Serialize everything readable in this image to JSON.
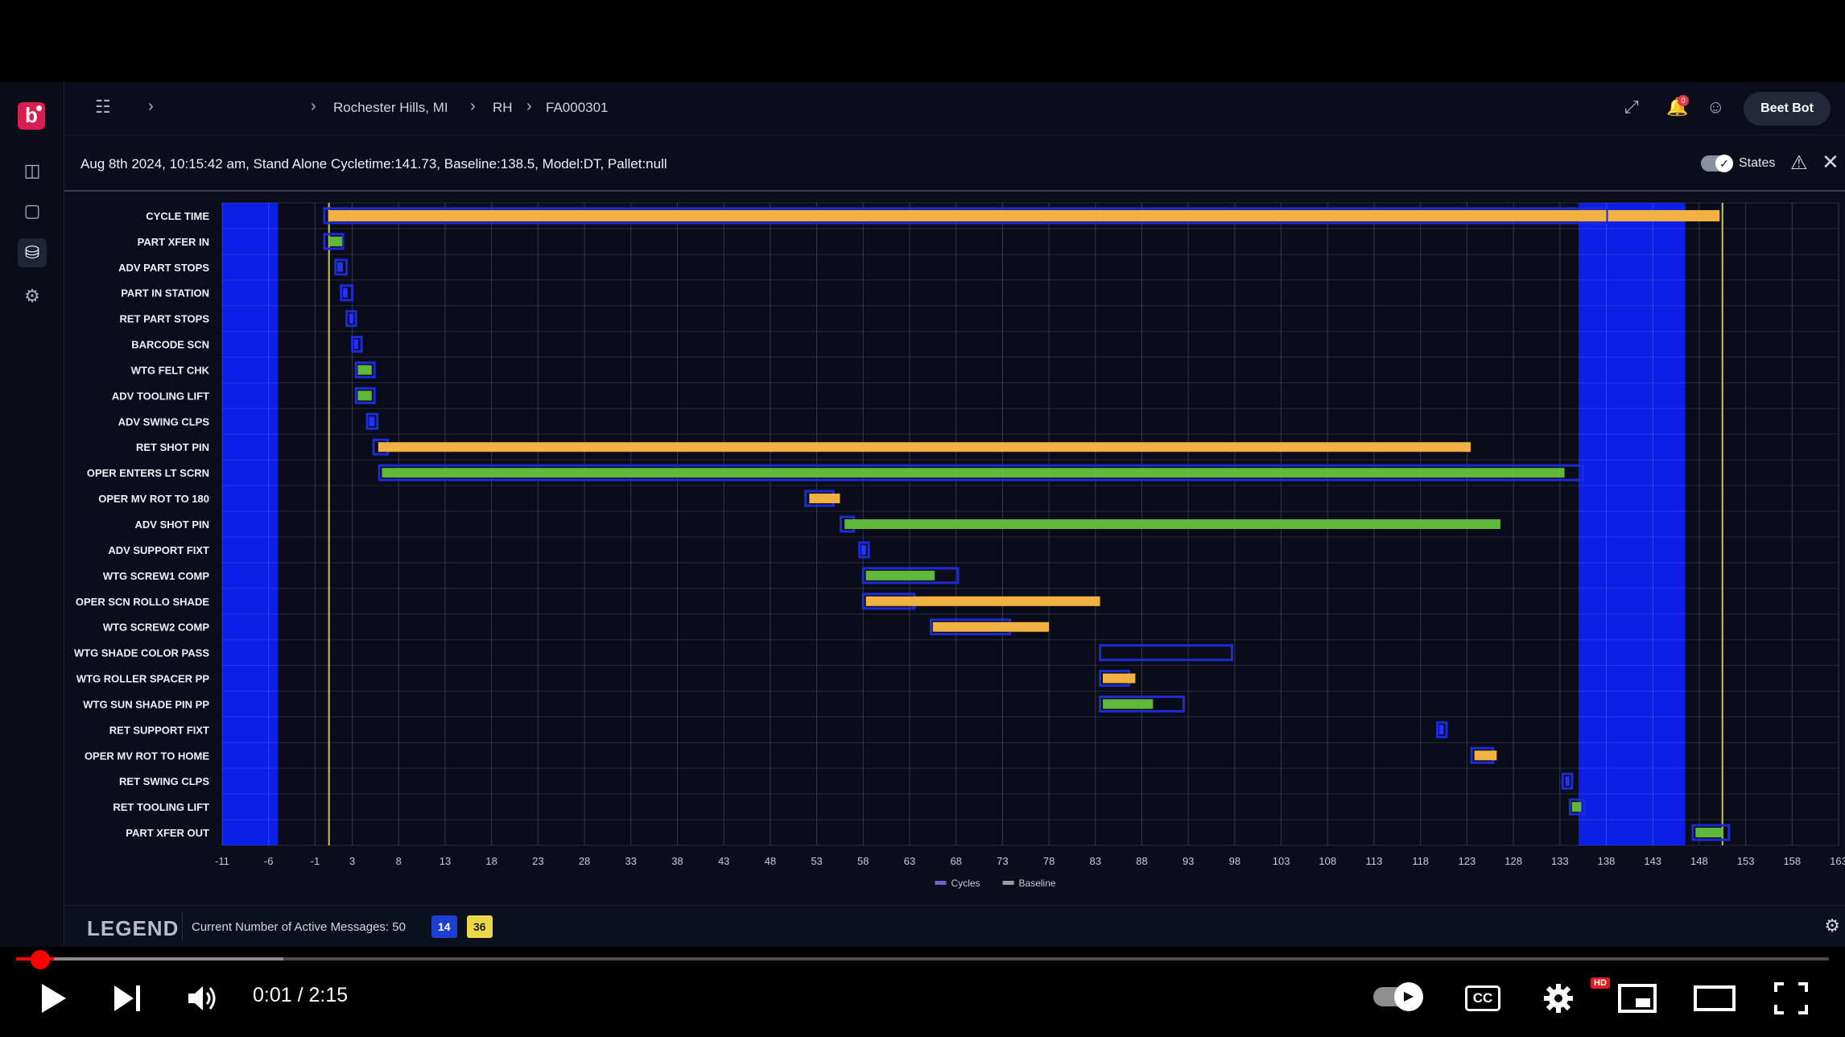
{
  "header": {
    "breadcrumb": [
      "Rochester Hills, MI",
      "RH",
      "FA000301"
    ],
    "user_button": "Beet Bot",
    "notification_count": "0"
  },
  "info": {
    "summary": "Aug 8th 2024, 10:15:42 am, Stand Alone Cycletime:141.73, Baseline:138.5, Model:DT, Pallet:null",
    "states_label": "States"
  },
  "legend": {
    "title": "LEGEND",
    "message": "Current Number of Active Messages: 50",
    "blue_count": "14",
    "yellow_count": "36"
  },
  "player": {
    "time": "0:01 / 2:15",
    "progress_fraction": 0.0074,
    "buffered_fraction": 0.1475,
    "cc_label": "CC",
    "hd_label": "HD"
  },
  "colors": {
    "background": "#0b0e1a",
    "baseline_outline": "#1c2bd6",
    "cycle_orange": "#f2b142",
    "cycle_green": "#5fb83a",
    "state_blue": "#0b1fe6",
    "marker_yellow": "#c8c45a"
  },
  "chart_data": {
    "type": "gantt",
    "x_ticks": [
      -11,
      -6,
      -1,
      3,
      8,
      13,
      18,
      23,
      28,
      33,
      38,
      43,
      48,
      53,
      58,
      63,
      68,
      73,
      78,
      83,
      88,
      93,
      98,
      103,
      108,
      113,
      118,
      123,
      128,
      133,
      138,
      143,
      148,
      153,
      158,
      163
    ],
    "xlim": [
      -11,
      163
    ],
    "legend": [
      "Cycles",
      "Baseline"
    ],
    "state_bands": [
      [
        -11,
        -5
      ],
      [
        135,
        146.5
      ]
    ],
    "markers": [
      0.5,
      150.5
    ],
    "rows": [
      {
        "label": "CYCLE TIME",
        "cycle": [
          0.4,
          150.2
        ],
        "cycle_color": "orange",
        "baseline": [
          0,
          138
        ],
        "split": 138
      },
      {
        "label": "PART XFER IN",
        "cycle": [
          0.5,
          1.9
        ],
        "cycle_color": "green",
        "baseline": [
          0,
          2
        ]
      },
      {
        "label": "ADV PART STOPS",
        "cycle": [
          1.4,
          2.0
        ],
        "cycle_color": "blue",
        "baseline": [
          1.2,
          2.4
        ]
      },
      {
        "label": "PART IN STATION",
        "cycle": [
          2.0,
          2.5
        ],
        "cycle_color": "blue",
        "baseline": [
          1.8,
          3.0
        ]
      },
      {
        "label": "RET PART STOPS",
        "cycle": [
          2.7,
          3.1
        ],
        "cycle_color": "blue",
        "baseline": [
          2.4,
          3.4
        ]
      },
      {
        "label": "BARCODE SCN",
        "cycle": [
          3.2,
          3.6
        ],
        "cycle_color": "blue",
        "baseline": [
          3.0,
          4.0
        ]
      },
      {
        "label": "WTG FELT CHK",
        "cycle": [
          3.6,
          5.1
        ],
        "cycle_color": "green",
        "baseline": [
          3.4,
          5.4
        ]
      },
      {
        "label": "ADV TOOLING LIFT",
        "cycle": [
          3.6,
          5.1
        ],
        "cycle_color": "green",
        "baseline": [
          3.4,
          5.4
        ]
      },
      {
        "label": "ADV SWING CLPS",
        "cycle": [
          4.8,
          5.4
        ],
        "cycle_color": "blue",
        "baseline": [
          4.6,
          5.7
        ]
      },
      {
        "label": "RET SHOT PIN",
        "cycle": [
          5.8,
          123.4
        ],
        "cycle_color": "orange",
        "baseline": [
          5.3,
          6.8
        ]
      },
      {
        "label": "OPER ENTERS LT SCRN",
        "cycle": [
          6.2,
          133.5
        ],
        "cycle_color": "green",
        "baseline": [
          5.9,
          135.5
        ]
      },
      {
        "label": "OPER MV ROT TO 180",
        "cycle": [
          52.2,
          55.5
        ],
        "cycle_color": "orange",
        "baseline": [
          51.8,
          54.8
        ]
      },
      {
        "label": "ADV SHOT PIN",
        "cycle": [
          56.0,
          126.6
        ],
        "cycle_color": "green",
        "baseline": [
          55.6,
          57.0
        ]
      },
      {
        "label": "ADV SUPPORT FIXT",
        "cycle": [
          57.8,
          58.3
        ],
        "cycle_color": "blue",
        "baseline": [
          57.6,
          58.6
        ]
      },
      {
        "label": "WTG SCREW1 COMP",
        "cycle": [
          58.3,
          65.7
        ],
        "cycle_color": "green",
        "baseline": [
          58.0,
          68.2
        ]
      },
      {
        "label": "OPER SCN ROLLO SHADE",
        "cycle": [
          58.3,
          83.5
        ],
        "cycle_color": "orange",
        "baseline": [
          58.0,
          63.5
        ]
      },
      {
        "label": "WTG SCREW2 COMP",
        "cycle": [
          65.5,
          78.0
        ],
        "cycle_color": "orange",
        "baseline": [
          65.3,
          73.8
        ]
      },
      {
        "label": "WTG SHADE COLOR PASS",
        "cycle": null,
        "cycle_color": "none",
        "baseline": [
          83.5,
          97.7
        ]
      },
      {
        "label": "WTG ROLLER SPACER PP",
        "cycle": [
          83.8,
          87.3
        ],
        "cycle_color": "orange",
        "baseline": [
          83.5,
          86.6
        ]
      },
      {
        "label": "WTG SUN SHADE PIN PP",
        "cycle": [
          83.8,
          89.2
        ],
        "cycle_color": "green",
        "baseline": [
          83.5,
          92.5
        ]
      },
      {
        "label": "RET SUPPORT FIXT",
        "cycle": [
          120.0,
          120.5
        ],
        "cycle_color": "blue",
        "baseline": [
          119.8,
          120.8
        ]
      },
      {
        "label": "OPER MV ROT TO HOME",
        "cycle": [
          123.8,
          126.2
        ],
        "cycle_color": "orange",
        "baseline": [
          123.5,
          125.8
        ]
      },
      {
        "label": "RET SWING CLPS",
        "cycle": [
          133.6,
          134.0
        ],
        "cycle_color": "blue",
        "baseline": [
          133.3,
          134.3
        ]
      },
      {
        "label": "RET TOOLING LIFT",
        "cycle": [
          134.3,
          135.3
        ],
        "cycle_color": "green",
        "baseline": [
          134.1,
          135.6
        ]
      },
      {
        "label": "PART XFER OUT",
        "cycle": [
          147.6,
          150.5
        ],
        "cycle_color": "green",
        "baseline": [
          147.3,
          151.2
        ]
      }
    ]
  }
}
